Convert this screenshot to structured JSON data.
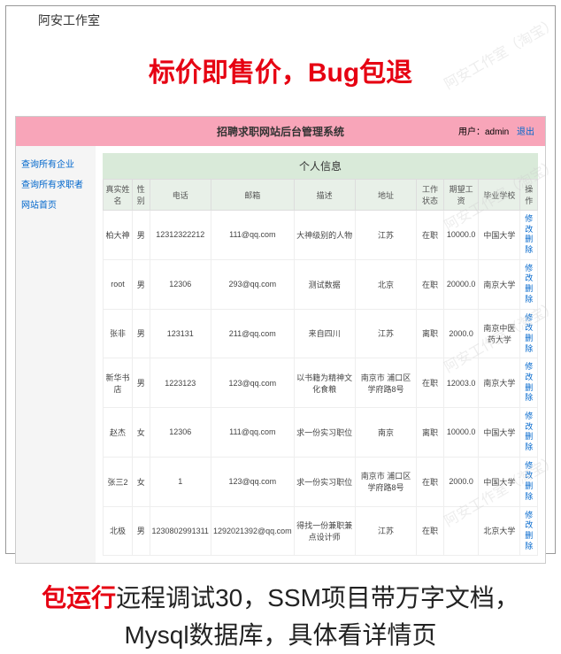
{
  "studio": "阿安工作室",
  "headline1": "标价即售价，Bug包退",
  "watermark": "阿安工作室（淘宝）",
  "app": {
    "title": "招聘求职网站后台管理系统",
    "user_label": "用户：",
    "username": "admin",
    "logout": "退出"
  },
  "sidebar": {
    "items": [
      {
        "label": "查询所有企业"
      },
      {
        "label": "查询所有求职者"
      },
      {
        "label": "网站首页"
      }
    ]
  },
  "panel": {
    "title": "个人信息",
    "columns": [
      "真实姓名",
      "性别",
      "电话",
      "邮箱",
      "描述",
      "地址",
      "工作状态",
      "期望工资",
      "毕业学校",
      "操作"
    ],
    "ops": {
      "edit": "修改",
      "del": "删除"
    },
    "rows": [
      {
        "name": "柏大神",
        "gender": "男",
        "phone": "12312322212",
        "email": "111@qq.com",
        "desc": "大神级别的人物",
        "addr": "江苏",
        "status": "在职",
        "salary": "10000.0",
        "school": "中国大学"
      },
      {
        "name": "root",
        "gender": "男",
        "phone": "12306",
        "email": "293@qq.com",
        "desc": "测试数据",
        "addr": "北京",
        "status": "在职",
        "salary": "20000.0",
        "school": "南京大学"
      },
      {
        "name": "张非",
        "gender": "男",
        "phone": "123131",
        "email": "211@qq.com",
        "desc": "来自四川",
        "addr": "江苏",
        "status": "离职",
        "salary": "2000.0",
        "school": "南京中医药大学"
      },
      {
        "name": "新华书店",
        "gender": "男",
        "phone": "1223123",
        "email": "123@qq.com",
        "desc": "以书籍为精神文化食粮",
        "addr": "南京市 浦口区 学府路8号",
        "status": "在职",
        "salary": "12003.0",
        "school": "南京大学"
      },
      {
        "name": "赵杰",
        "gender": "女",
        "phone": "12306",
        "email": "111@qq.com",
        "desc": "求一份实习职位",
        "addr": "南京",
        "status": "离职",
        "salary": "10000.0",
        "school": "中国大学"
      },
      {
        "name": "张三2",
        "gender": "女",
        "phone": "1",
        "email": "123@qq.com",
        "desc": "求一份实习职位",
        "addr": "南京市 浦口区 学府路8号",
        "status": "在职",
        "salary": "2000.0",
        "school": "中国大学"
      },
      {
        "name": "北极",
        "gender": "男",
        "phone": "1230802991311",
        "email": "1292021392@qq.com",
        "desc": "得找一份兼职兼点设计师",
        "addr": "江苏",
        "status": "在职",
        "salary": "",
        "school": "北京大学"
      }
    ]
  },
  "headline2": {
    "red": "包运行",
    "rest": "远程调试30，SSM项目带万字文档，Mysql数据库，具体看详情页"
  }
}
